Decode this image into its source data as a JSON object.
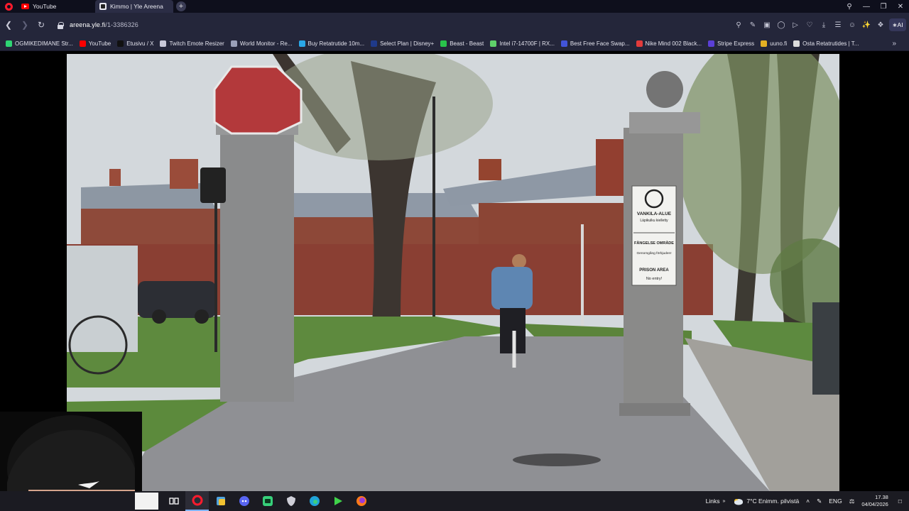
{
  "browser": {
    "tabs": [
      {
        "label": "YouTube",
        "favicon": "youtube-icon",
        "active": false
      },
      {
        "label": "Kimmo | Yle Areena",
        "favicon": "yle-icon",
        "active": true
      }
    ],
    "url": {
      "domain": "areena.yle.fi",
      "path": "/1-3386326"
    },
    "bookmarks": [
      {
        "label": "OGMIKEDIMANE Str...",
        "color": "#2ed573"
      },
      {
        "label": "YouTube",
        "color": "#ff0000"
      },
      {
        "label": "Etusivu / X",
        "color": "#111111"
      },
      {
        "label": "Twitch Emote Resizer",
        "color": "#c8c8d8"
      },
      {
        "label": "World Monitor - Re...",
        "color": "#9aa0b8"
      },
      {
        "label": "Buy Retatrutide 10m...",
        "color": "#2aa7e8"
      },
      {
        "label": "Select Plan | Disney+",
        "color": "#1f3a8a"
      },
      {
        "label": "Beast - Beast",
        "color": "#29c24b"
      },
      {
        "label": "Intel i7-14700F | RX...",
        "color": "#5fd16a"
      },
      {
        "label": "Best Free Face Swap...",
        "color": "#4254d8"
      },
      {
        "label": "Nike Mind 002 Black...",
        "color": "#e33b3b"
      },
      {
        "label": "Stripe Express",
        "color": "#5b3fd6"
      },
      {
        "label": "uuno.fi",
        "color": "#e3b024"
      },
      {
        "label": "Osta Retatrutides | T...",
        "color": "#dcdcdc"
      }
    ]
  },
  "video": {
    "sign_lines": [
      "VANKILA-ALUE",
      "Läpikulku kielletty",
      "FÄNGELSE OMRÅDE",
      "Genomgång förbjuden!",
      "PRISON AREA",
      "No entry!"
    ]
  },
  "taskbar": {
    "tray": {
      "links": "Links",
      "weather": "7°C  Enimm. pilvistä",
      "language": "ENG",
      "time": "17.38",
      "date": "04/04/2026"
    }
  }
}
